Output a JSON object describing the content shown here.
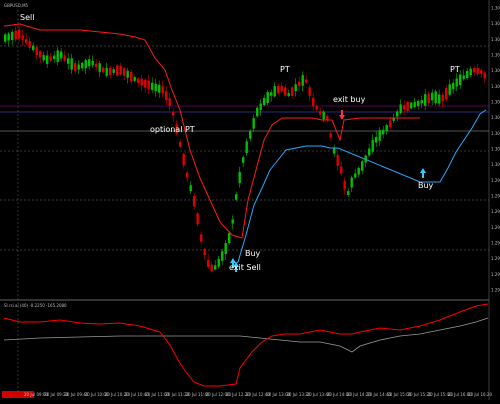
{
  "window": {
    "symbol_caption": "GBPUSD,M5",
    "indicator_caption": "Sl.rsi.ai (40) -0.2250 -165.2080"
  },
  "chart_data": {
    "type": "candlestick",
    "price_axis_labels": [
      "1.30250",
      "1.30225",
      "1.30200",
      "1.30175",
      "1.30150",
      "1.30125",
      "1.30100",
      "1.30075",
      "1.30050",
      "1.30025",
      "1.30000",
      "1.29975",
      "1.29950",
      "1.29925",
      "1.29900",
      "1.29875",
      "1.29850",
      "1.29825",
      "1.29800"
    ],
    "time_axis_labels": [
      "20 Jul 09:00",
      "20 Jul 09:20",
      "20 Jul 09:40",
      "20 Jul 10:00",
      "20 Jul 10:20",
      "20 Jul 10:40",
      "20 Jul 11:00",
      "20 Jul 11:20",
      "20 Jul 11:40",
      "20 Jul 12:00",
      "20 Jul 12:20",
      "20 Jul 12:40",
      "20 Jul 13:00",
      "20 Jul 13:20",
      "20 Jul 13:40",
      "20 Jul 14:00",
      "20 Jul 14:20",
      "20 Jul 14:40",
      "20 Jul 15:00",
      "20 Jul 15:20",
      "20 Jul 15:40",
      "20 Jul 16:00",
      "20 Jul 16:20"
    ],
    "annotations": [
      "Sell",
      "optional PT",
      "PT",
      "exit buy",
      "Buy",
      "exit Sell",
      "Buy",
      "PT"
    ],
    "colors": {
      "background": "#000000",
      "bull_candle": "#00c000",
      "bear_candle": "#e00000",
      "sell_stop_line": "#ff1a1a",
      "buy_stop_line": "#2aa8ff",
      "arrow_sell": "#ff3333",
      "arrow_buy": "#33ccff",
      "indicator_main": "#ff0000",
      "indicator_signal": "#9a9a9a"
    }
  }
}
